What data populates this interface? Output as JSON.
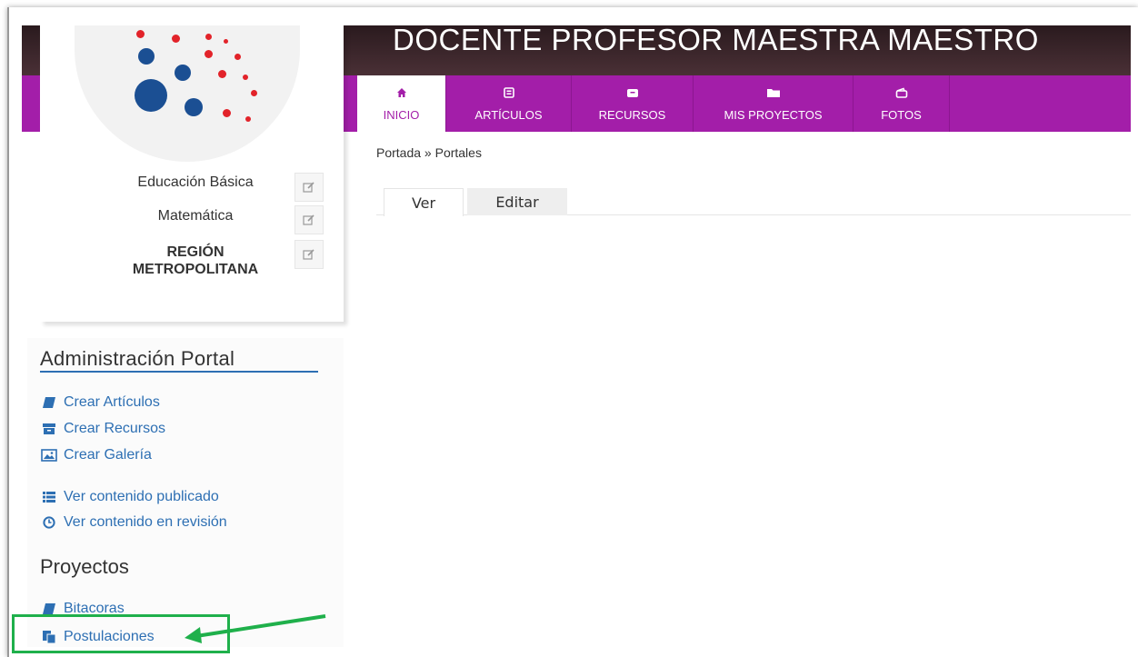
{
  "header": {
    "title": "DOCENTE PROFESOR MAESTRA MAESTRO"
  },
  "nav": {
    "items": [
      {
        "label": "INICIO",
        "icon": "home-icon"
      },
      {
        "label": "ARTÍCULOS",
        "icon": "article-icon"
      },
      {
        "label": "RECURSOS",
        "icon": "archive-icon"
      },
      {
        "label": "MIS PROYECTOS",
        "icon": "folder-icon"
      },
      {
        "label": "FOTOS",
        "icon": "photos-icon"
      }
    ],
    "active": "INICIO"
  },
  "profile": {
    "tags": [
      "Educación Básica",
      "Matemática"
    ],
    "region_line1": "REGIÓN",
    "region_line2": "METROPOLITANA"
  },
  "breadcrumb": "Portada » Portales",
  "tabs": [
    "Ver",
    "Editar"
  ],
  "admin": {
    "title": "Administración Portal",
    "create_links": [
      "Crear Artículos",
      "Crear Recursos",
      "Crear Galería"
    ],
    "view_links": [
      "Ver contenido publicado",
      "Ver contenido en revisión"
    ]
  },
  "projects": {
    "title": "Proyectos",
    "links": [
      "Bitacoras",
      "Postulaciones"
    ]
  },
  "colors": {
    "accent": "#a31ea9",
    "link": "#2d6fb3",
    "highlight": "#1fb04b",
    "logo_blue": "#1b4f93",
    "logo_red": "#e2232a"
  }
}
